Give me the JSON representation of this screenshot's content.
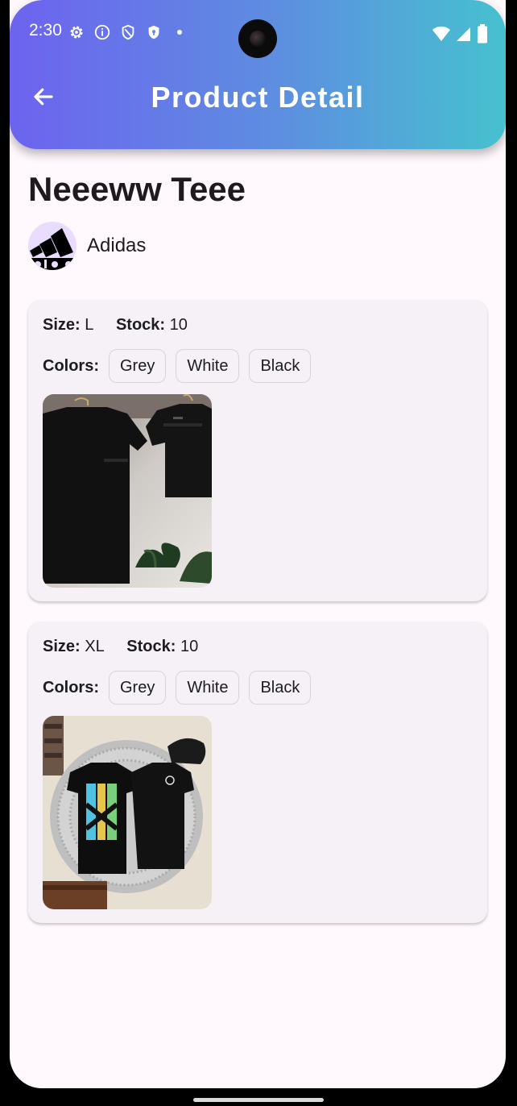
{
  "status_bar": {
    "time": "2:30",
    "left_icons": [
      "gear-icon",
      "info-icon",
      "shield-outline-icon",
      "shield-filled-icon"
    ],
    "right_icons": [
      "wifi-icon",
      "signal-icon",
      "battery-icon"
    ]
  },
  "app_bar": {
    "title": "Product Detail",
    "back_icon": "arrow-left-icon",
    "gradient": [
      "#6d63ef",
      "#46c1cf"
    ]
  },
  "product": {
    "name": "Neeeww Teee",
    "brand": "Adidas"
  },
  "labels": {
    "size": "Size:",
    "stock": "Stock:",
    "colors": "Colors:"
  },
  "variants": [
    {
      "size": "L",
      "stock": "10",
      "colors": [
        "Grey",
        "White",
        "Black"
      ]
    },
    {
      "size": "XL",
      "stock": "10",
      "colors": [
        "Grey",
        "White",
        "Black"
      ]
    }
  ],
  "colors": {
    "background": "#fff8fc",
    "card": "#f5f1f7",
    "text": "#1d1b20"
  }
}
